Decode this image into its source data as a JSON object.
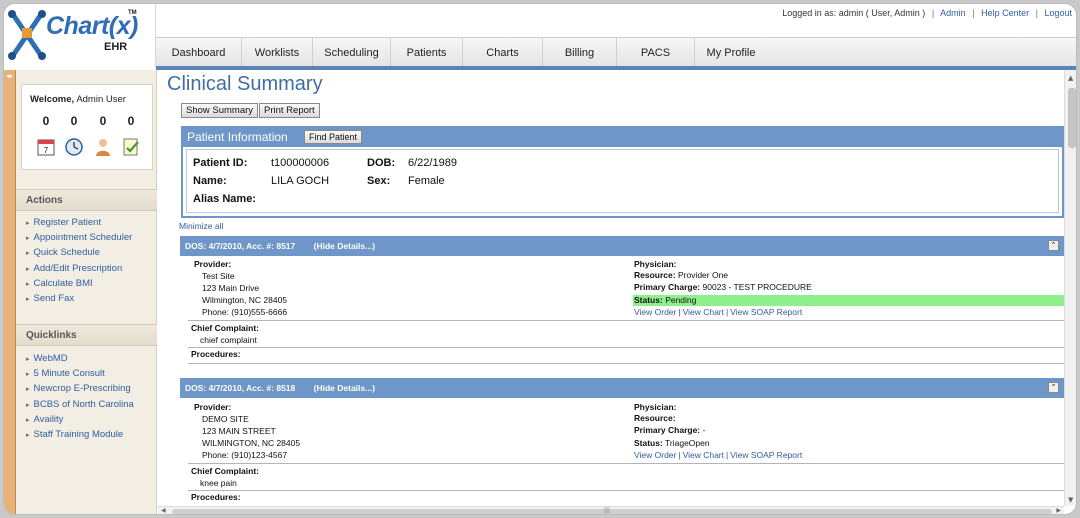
{
  "logo": {
    "text": "Chart",
    "suffix": "(x)",
    "sub": "EHR",
    "tm": "TM"
  },
  "top_links": {
    "logged_in": "Logged in as: admin ( User, Admin )",
    "separator": "|",
    "admin": "Admin",
    "help": "Help Center",
    "logout": "Logout"
  },
  "nav": [
    "Dashboard",
    "Worklists",
    "Scheduling",
    "Patients",
    "Charts",
    "Billing",
    "PACS",
    "My Profile"
  ],
  "sidebar": {
    "welcome_word": "Welcome,",
    "welcome_user": "Admin User",
    "counts": [
      "0",
      "0",
      "0",
      "0"
    ],
    "icons": [
      "calendar-icon",
      "clock-icon",
      "user-icon",
      "checklist-icon"
    ],
    "actions_title": "Actions",
    "actions": [
      "Register Patient",
      "Appointment Scheduler",
      "Quick Schedule",
      "Add/Edit Prescription",
      "Calculate BMI",
      "Send Fax"
    ],
    "quicklinks_title": "Quicklinks",
    "quicklinks": [
      "WebMD",
      "5 Minute Consult",
      "Newcrop E-Prescribing",
      "BCBS of North Carolina",
      "Availity",
      "Staff Training Module"
    ]
  },
  "main": {
    "title": "Clinical Summary",
    "show_summary": "Show Summary",
    "print_report": "Print Report",
    "patient_info_title": "Patient Information",
    "find_patient": "Find Patient",
    "patient": {
      "id_label": "Patient ID:",
      "id": "t100000006",
      "dob_label": "DOB:",
      "dob": "6/22/1989",
      "name_label": "Name:",
      "name": "LILA GOCH",
      "sex_label": "Sex:",
      "sex": "Female",
      "alias_label": "Alias Name:"
    },
    "minimize_all": "Minimize all"
  },
  "encounters": [
    {
      "header": "DOS: 4/7/2010, Acc. #: 8517",
      "hide": "(Hide Details...)",
      "provider_label": "Provider:",
      "provider_lines": [
        "Test Site",
        "123 Main Drive",
        "Wilmington, NC 28405",
        "Phone: (910)555-6666"
      ],
      "physician_label": "Physician:",
      "resource_label": "Resource:",
      "resource": "Provider One",
      "primary_label": "Primary Charge:",
      "primary": "90023 - TEST PROCEDURE",
      "status_label": "Status:",
      "status": "Pending",
      "links": [
        "View Order",
        "View Chart",
        "View SOAP Report"
      ],
      "complaint_label": "Chief Complaint:",
      "complaint": "chief complaint",
      "procedures_label": "Procedures:"
    },
    {
      "header": "DOS: 4/7/2010, Acc. #: 8518",
      "hide": "(Hide Details...)",
      "provider_label": "Provider:",
      "provider_lines": [
        "DEMO SITE",
        "123 MAIN STREET",
        "WILMINGTON, NC 28405",
        "Phone: (910)123-4567"
      ],
      "physician_label": "Physician:",
      "resource_label": "Resource:",
      "resource": "",
      "primary_label": "Primary Charge:",
      "primary": "-",
      "status_label": "Status:",
      "status": "TriageOpen",
      "links": [
        "View Order",
        "View Chart",
        "View SOAP Report"
      ],
      "complaint_label": "Chief Complaint:",
      "complaint": "knee pain",
      "procedures_label": "Procedures:"
    }
  ],
  "colors": {
    "accent": "#6e96c8",
    "link": "#2f5f9e",
    "status_pending": "#8df08d",
    "sidebar_edge": "#e7b27a"
  }
}
